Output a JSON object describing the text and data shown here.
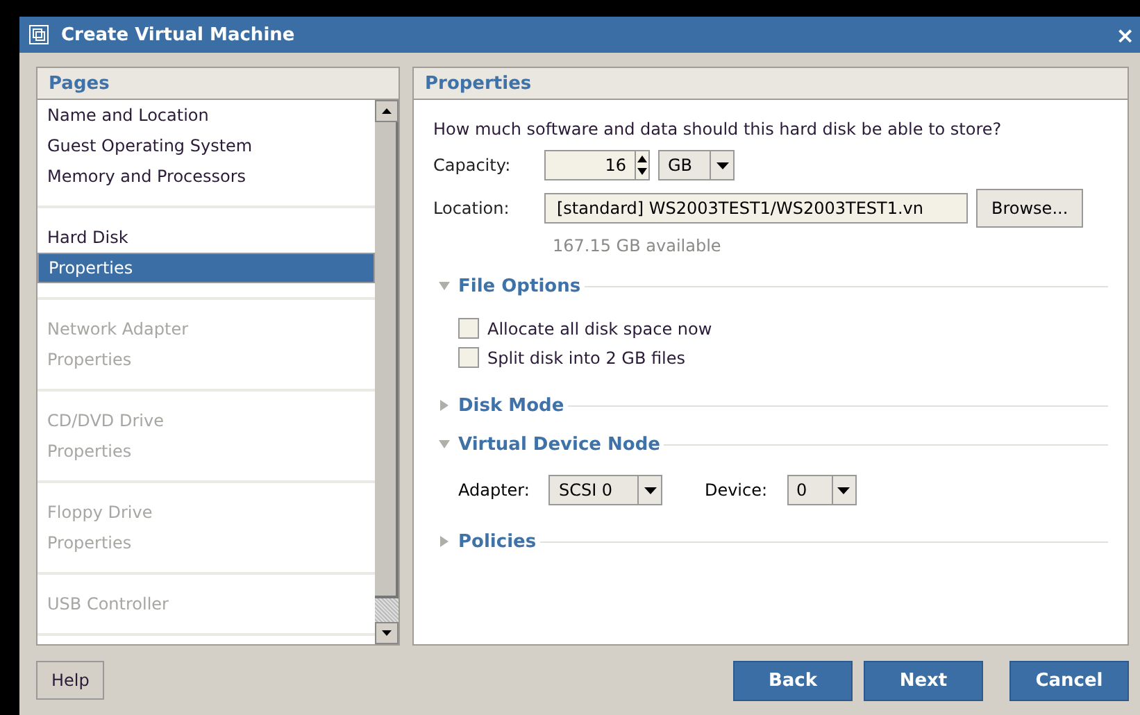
{
  "window": {
    "title": "Create Virtual Machine",
    "close": "×"
  },
  "pages": {
    "title": "Pages",
    "groups": [
      {
        "items": [
          {
            "label": "Name and Location",
            "selected": false,
            "disabled": false
          },
          {
            "label": "Guest Operating System",
            "selected": false,
            "disabled": false
          },
          {
            "label": "Memory and Processors",
            "selected": false,
            "disabled": false
          }
        ]
      },
      {
        "items": [
          {
            "label": "Hard Disk",
            "selected": false,
            "disabled": false
          },
          {
            "label": "Properties",
            "selected": true,
            "disabled": false
          }
        ]
      },
      {
        "items": [
          {
            "label": "Network Adapter",
            "selected": false,
            "disabled": true
          },
          {
            "label": "Properties",
            "selected": false,
            "disabled": true
          }
        ]
      },
      {
        "items": [
          {
            "label": "CD/DVD Drive",
            "selected": false,
            "disabled": true
          },
          {
            "label": "Properties",
            "selected": false,
            "disabled": true
          }
        ]
      },
      {
        "items": [
          {
            "label": "Floppy Drive",
            "selected": false,
            "disabled": true
          },
          {
            "label": "Properties",
            "selected": false,
            "disabled": true
          }
        ]
      },
      {
        "items": [
          {
            "label": "USB Controller",
            "selected": false,
            "disabled": true
          }
        ]
      }
    ]
  },
  "properties": {
    "title": "Properties",
    "question": "How much software and data should this hard disk be able to store?",
    "capacity": {
      "label": "Capacity:",
      "value": "16",
      "unit": "GB"
    },
    "location": {
      "label": "Location:",
      "value": "[standard] WS2003TEST1/WS2003TEST1.vn",
      "button": "Browse..."
    },
    "available": "167.15 GB available",
    "sections": [
      {
        "title": "File Options",
        "expanded": true,
        "kind": "checks",
        "options": [
          {
            "label": "Allocate all disk space now",
            "checked": false
          },
          {
            "label": "Split disk into 2 GB files",
            "checked": false
          }
        ]
      },
      {
        "title": "Disk Mode",
        "expanded": false
      },
      {
        "title": "Virtual Device Node",
        "expanded": true,
        "kind": "selects",
        "selects": [
          {
            "label": "Adapter:",
            "value": "SCSI 0"
          },
          {
            "label": "Device:",
            "value": "0"
          }
        ]
      },
      {
        "title": "Policies",
        "expanded": false
      }
    ]
  },
  "buttons": {
    "help": "Help",
    "actions": [
      "Back",
      "Next",
      "Cancel"
    ]
  }
}
